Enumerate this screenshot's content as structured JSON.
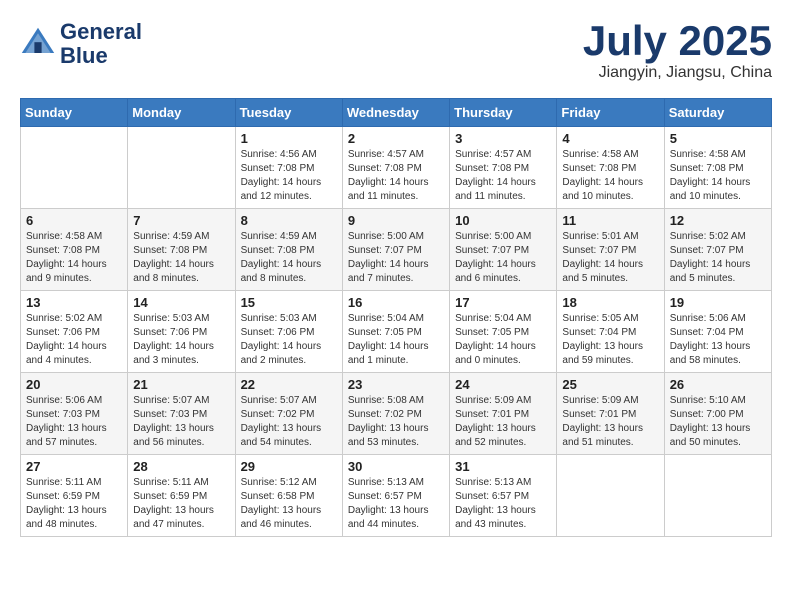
{
  "header": {
    "logo_line1": "General",
    "logo_line2": "Blue",
    "title": "July 2025",
    "location": "Jiangyin, Jiangsu, China"
  },
  "weekdays": [
    "Sunday",
    "Monday",
    "Tuesday",
    "Wednesday",
    "Thursday",
    "Friday",
    "Saturday"
  ],
  "weeks": [
    [
      {
        "day": "",
        "detail": ""
      },
      {
        "day": "",
        "detail": ""
      },
      {
        "day": "1",
        "detail": "Sunrise: 4:56 AM\nSunset: 7:08 PM\nDaylight: 14 hours\nand 12 minutes."
      },
      {
        "day": "2",
        "detail": "Sunrise: 4:57 AM\nSunset: 7:08 PM\nDaylight: 14 hours\nand 11 minutes."
      },
      {
        "day": "3",
        "detail": "Sunrise: 4:57 AM\nSunset: 7:08 PM\nDaylight: 14 hours\nand 11 minutes."
      },
      {
        "day": "4",
        "detail": "Sunrise: 4:58 AM\nSunset: 7:08 PM\nDaylight: 14 hours\nand 10 minutes."
      },
      {
        "day": "5",
        "detail": "Sunrise: 4:58 AM\nSunset: 7:08 PM\nDaylight: 14 hours\nand 10 minutes."
      }
    ],
    [
      {
        "day": "6",
        "detail": "Sunrise: 4:58 AM\nSunset: 7:08 PM\nDaylight: 14 hours\nand 9 minutes."
      },
      {
        "day": "7",
        "detail": "Sunrise: 4:59 AM\nSunset: 7:08 PM\nDaylight: 14 hours\nand 8 minutes."
      },
      {
        "day": "8",
        "detail": "Sunrise: 4:59 AM\nSunset: 7:08 PM\nDaylight: 14 hours\nand 8 minutes."
      },
      {
        "day": "9",
        "detail": "Sunrise: 5:00 AM\nSunset: 7:07 PM\nDaylight: 14 hours\nand 7 minutes."
      },
      {
        "day": "10",
        "detail": "Sunrise: 5:00 AM\nSunset: 7:07 PM\nDaylight: 14 hours\nand 6 minutes."
      },
      {
        "day": "11",
        "detail": "Sunrise: 5:01 AM\nSunset: 7:07 PM\nDaylight: 14 hours\nand 5 minutes."
      },
      {
        "day": "12",
        "detail": "Sunrise: 5:02 AM\nSunset: 7:07 PM\nDaylight: 14 hours\nand 5 minutes."
      }
    ],
    [
      {
        "day": "13",
        "detail": "Sunrise: 5:02 AM\nSunset: 7:06 PM\nDaylight: 14 hours\nand 4 minutes."
      },
      {
        "day": "14",
        "detail": "Sunrise: 5:03 AM\nSunset: 7:06 PM\nDaylight: 14 hours\nand 3 minutes."
      },
      {
        "day": "15",
        "detail": "Sunrise: 5:03 AM\nSunset: 7:06 PM\nDaylight: 14 hours\nand 2 minutes."
      },
      {
        "day": "16",
        "detail": "Sunrise: 5:04 AM\nSunset: 7:05 PM\nDaylight: 14 hours\nand 1 minute."
      },
      {
        "day": "17",
        "detail": "Sunrise: 5:04 AM\nSunset: 7:05 PM\nDaylight: 14 hours\nand 0 minutes."
      },
      {
        "day": "18",
        "detail": "Sunrise: 5:05 AM\nSunset: 7:04 PM\nDaylight: 13 hours\nand 59 minutes."
      },
      {
        "day": "19",
        "detail": "Sunrise: 5:06 AM\nSunset: 7:04 PM\nDaylight: 13 hours\nand 58 minutes."
      }
    ],
    [
      {
        "day": "20",
        "detail": "Sunrise: 5:06 AM\nSunset: 7:03 PM\nDaylight: 13 hours\nand 57 minutes."
      },
      {
        "day": "21",
        "detail": "Sunrise: 5:07 AM\nSunset: 7:03 PM\nDaylight: 13 hours\nand 56 minutes."
      },
      {
        "day": "22",
        "detail": "Sunrise: 5:07 AM\nSunset: 7:02 PM\nDaylight: 13 hours\nand 54 minutes."
      },
      {
        "day": "23",
        "detail": "Sunrise: 5:08 AM\nSunset: 7:02 PM\nDaylight: 13 hours\nand 53 minutes."
      },
      {
        "day": "24",
        "detail": "Sunrise: 5:09 AM\nSunset: 7:01 PM\nDaylight: 13 hours\nand 52 minutes."
      },
      {
        "day": "25",
        "detail": "Sunrise: 5:09 AM\nSunset: 7:01 PM\nDaylight: 13 hours\nand 51 minutes."
      },
      {
        "day": "26",
        "detail": "Sunrise: 5:10 AM\nSunset: 7:00 PM\nDaylight: 13 hours\nand 50 minutes."
      }
    ],
    [
      {
        "day": "27",
        "detail": "Sunrise: 5:11 AM\nSunset: 6:59 PM\nDaylight: 13 hours\nand 48 minutes."
      },
      {
        "day": "28",
        "detail": "Sunrise: 5:11 AM\nSunset: 6:59 PM\nDaylight: 13 hours\nand 47 minutes."
      },
      {
        "day": "29",
        "detail": "Sunrise: 5:12 AM\nSunset: 6:58 PM\nDaylight: 13 hours\nand 46 minutes."
      },
      {
        "day": "30",
        "detail": "Sunrise: 5:13 AM\nSunset: 6:57 PM\nDaylight: 13 hours\nand 44 minutes."
      },
      {
        "day": "31",
        "detail": "Sunrise: 5:13 AM\nSunset: 6:57 PM\nDaylight: 13 hours\nand 43 minutes."
      },
      {
        "day": "",
        "detail": ""
      },
      {
        "day": "",
        "detail": ""
      }
    ]
  ]
}
